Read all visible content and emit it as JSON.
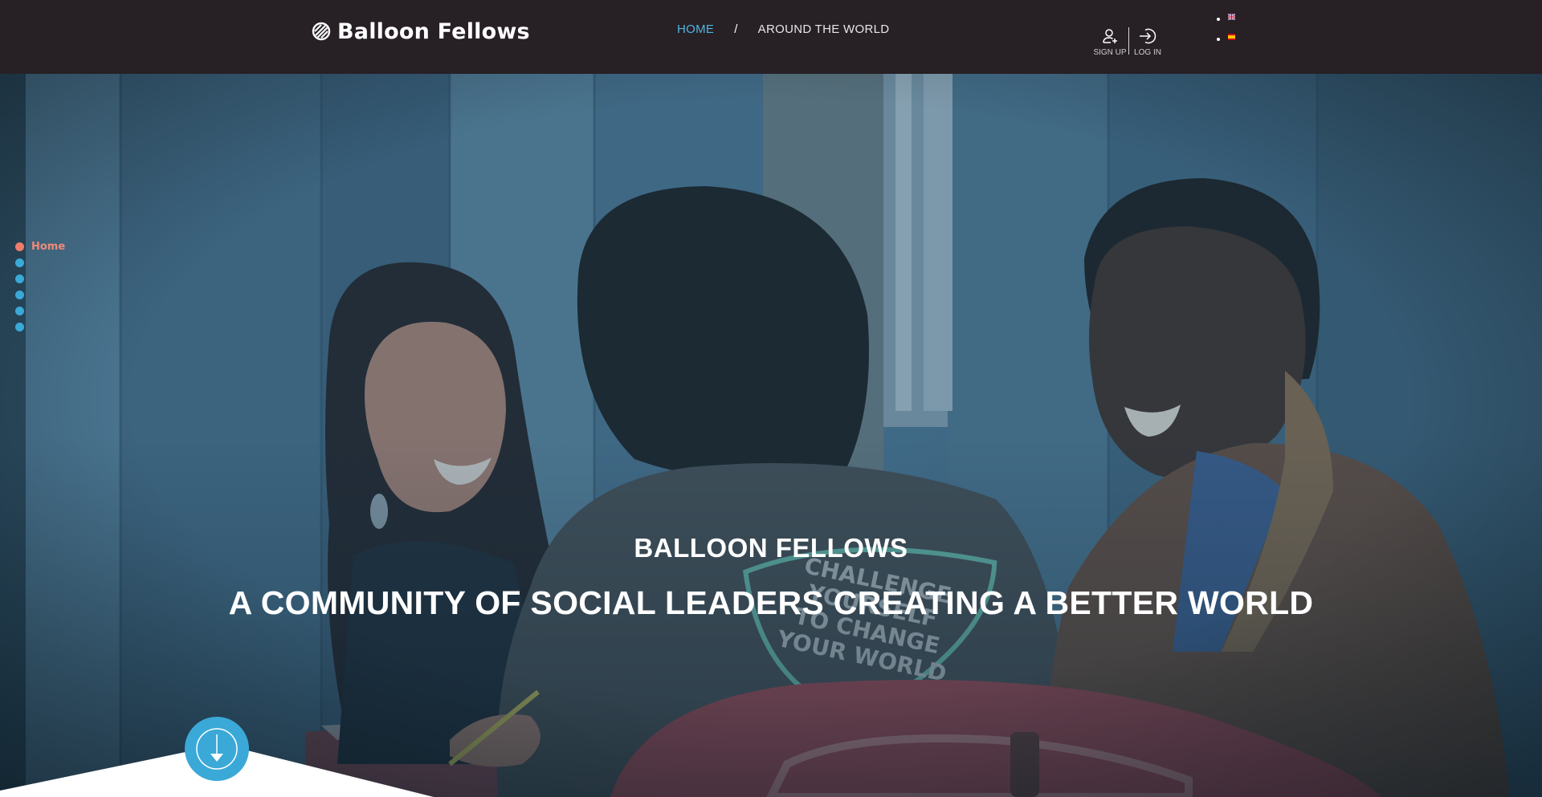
{
  "brand": {
    "name": "Balloon Fellows",
    "icon": "balloon-logo-icon"
  },
  "nav": {
    "home": "HOME",
    "separator": "/",
    "around_the_world": "AROUND THE WORLD",
    "active_color": "#4fb6e0"
  },
  "account": {
    "signup_label": "SIGN UP",
    "signup_icon": "user-add-icon",
    "login_label": "LOG IN",
    "login_icon": "login-arrow-icon"
  },
  "languages": [
    {
      "icon": "uk-flag-icon"
    },
    {
      "icon": "spain-flag-icon"
    }
  ],
  "section_nav": {
    "items": [
      {
        "label": "Home",
        "active": true
      },
      {
        "label": "",
        "active": false
      },
      {
        "label": "",
        "active": false
      },
      {
        "label": "",
        "active": false
      },
      {
        "label": "",
        "active": false
      },
      {
        "label": "",
        "active": false
      }
    ],
    "active_color": "#ee7d6c",
    "dot_color": "#3aa9d8"
  },
  "hero": {
    "subtitle": "BALLOON FELLOWS",
    "title": "A COMMUNITY OF SOCIAL LEADERS CREATING A BETTER WORLD",
    "shirt_text": [
      "CHALLENGE",
      "YOURSELF",
      "TO CHANGE",
      "YOUR WORLD"
    ],
    "scroll_icon": "scroll-down-arrow-icon",
    "overlay_color": "#2b4f66"
  }
}
